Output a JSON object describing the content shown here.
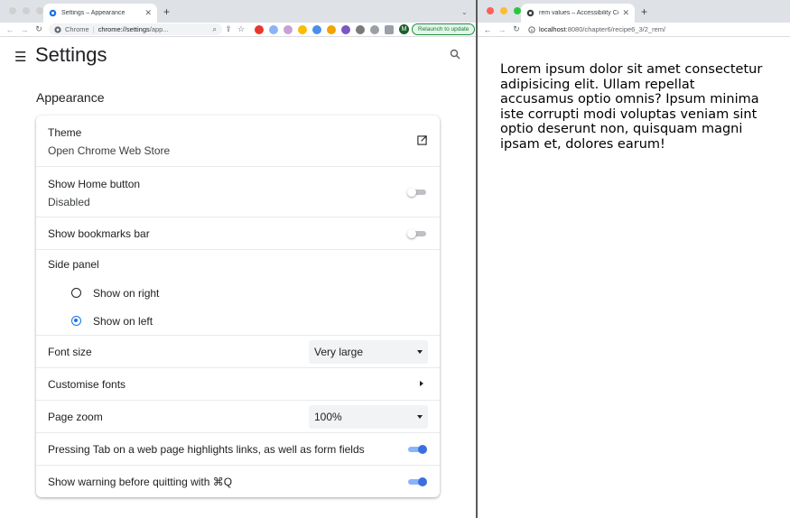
{
  "left_window": {
    "tab": {
      "title": "Settings – Appearance"
    },
    "url": {
      "scheme_label": "Chrome",
      "host": "chrome://settings",
      "path": "/app..."
    },
    "relaunch_label": "Relaunch to update",
    "avatar_letter": "M",
    "page": {
      "title": "Settings",
      "section": "Appearance",
      "theme": {
        "label": "Theme",
        "sub": "Open Chrome Web Store"
      },
      "home_button": {
        "label": "Show Home button",
        "sub": "Disabled",
        "on": false
      },
      "bookmarks_bar": {
        "label": "Show bookmarks bar",
        "on": false
      },
      "side_panel": {
        "label": "Side panel",
        "options": [
          {
            "label": "Show on right",
            "selected": false
          },
          {
            "label": "Show on left",
            "selected": true
          }
        ]
      },
      "font_size": {
        "label": "Font size",
        "value": "Very large"
      },
      "customise_fonts": {
        "label": "Customise fonts"
      },
      "page_zoom": {
        "label": "Page zoom",
        "value": "100%"
      },
      "tab_highlight": {
        "label": "Pressing Tab on a web page highlights links, as well as form fields",
        "on": true
      },
      "quit_warning": {
        "label": "Show warning before quitting with ⌘Q",
        "on": true
      }
    }
  },
  "right_window": {
    "tab": {
      "title": "rem values – Accessibility Co..."
    },
    "url": {
      "host": "localhost",
      "rest": ":8080/chapter6/recipe6_3/2_rem/"
    },
    "body_text": "Lorem ipsum dolor sit amet consectetur adipisicing elit. Ullam repellat accusamus optio omnis? Ipsum minima iste corrupti modi voluptas veniam sint optio deserunt non, quisquam magni ipsam et, dolores earum!"
  },
  "colors": {
    "toggle_on": "#3b6fe0",
    "accent": "#1a73e8",
    "relaunch": "#188038"
  }
}
